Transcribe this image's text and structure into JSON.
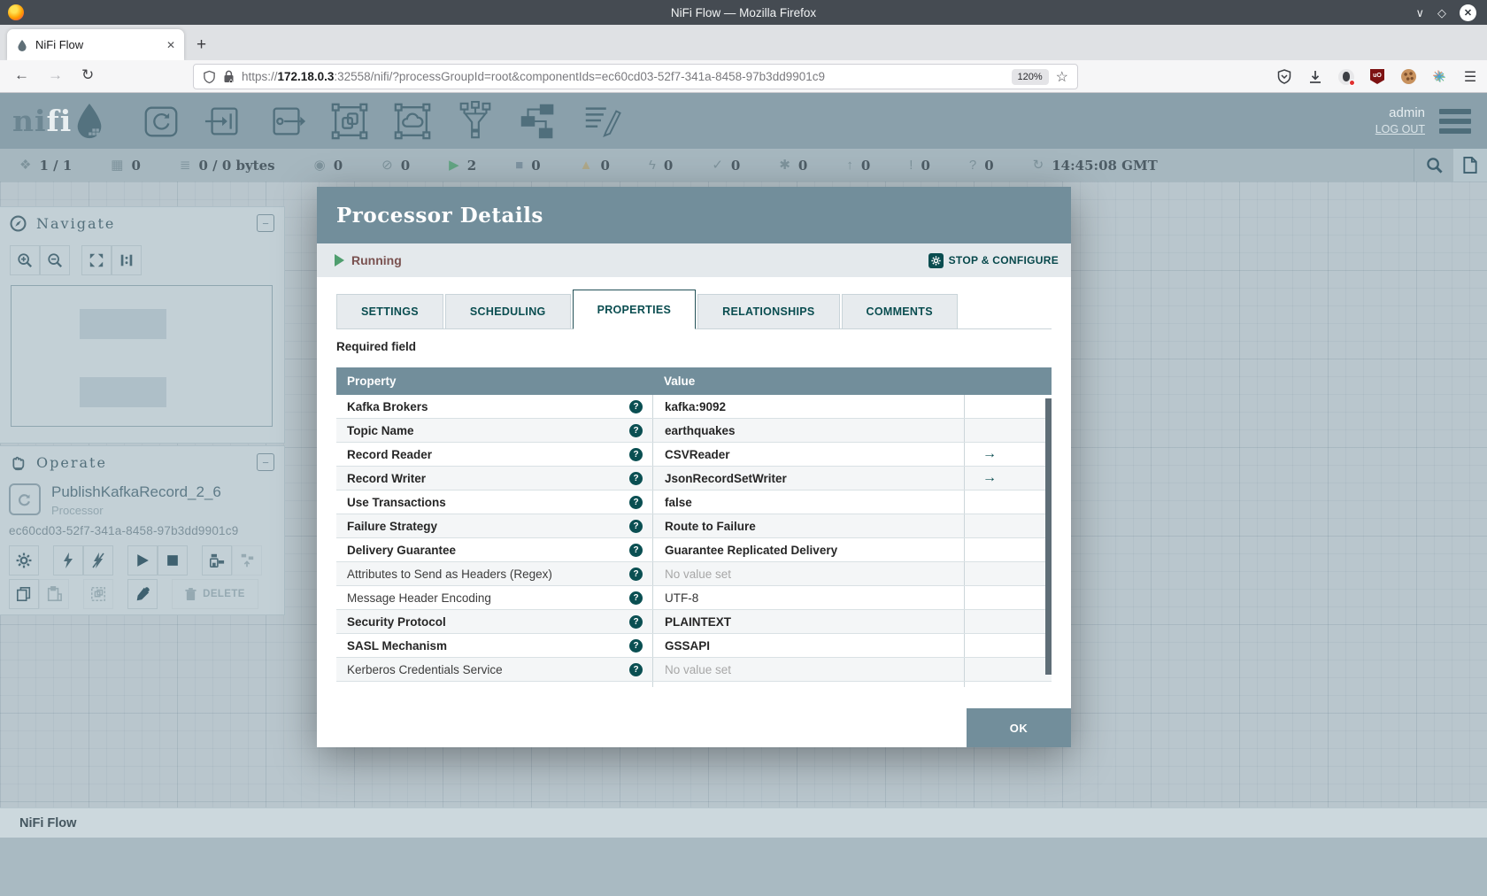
{
  "browser": {
    "window_title": "NiFi Flow — Mozilla Firefox",
    "tab_title": "NiFi Flow",
    "new_tab_label": "+",
    "close_tab_label": "✕",
    "url": {
      "scheme": "https://",
      "host": "172.18.0.3",
      "rest": ":32558/nifi/?processGroupId=root&componentIds=ec60cd03-52f7-341a-8458-97b3dd9901c9"
    },
    "zoom_badge": "120%"
  },
  "nifi": {
    "header": {
      "logo_ni": "ni",
      "logo_fi": "fi",
      "user": "admin",
      "logout": "LOG OUT"
    },
    "status": {
      "items": [
        {
          "name": "cluster-icon",
          "glyph": "❖",
          "value": "1 / 1"
        },
        {
          "name": "active-threads-icon",
          "glyph": "▦",
          "value": "0"
        },
        {
          "name": "queued-icon",
          "glyph": "≣",
          "value": "0 / 0 bytes"
        },
        {
          "name": "transmitting-icon",
          "glyph": "◉",
          "value": "0"
        },
        {
          "name": "not-transmitting-icon",
          "glyph": "⊘",
          "value": "0"
        },
        {
          "name": "running-icon",
          "glyph": "▶",
          "value": "2",
          "color": "#63a584"
        },
        {
          "name": "stopped-icon",
          "glyph": "■",
          "value": "0",
          "color": "#7d93a1"
        },
        {
          "name": "invalid-icon",
          "glyph": "▲",
          "value": "0",
          "color": "#b0a98a"
        },
        {
          "name": "disabled-icon",
          "glyph": "ϟ",
          "value": "0"
        },
        {
          "name": "up-to-date-icon",
          "glyph": "✓",
          "value": "0"
        },
        {
          "name": "locally-modified-icon",
          "glyph": "✱",
          "value": "0"
        },
        {
          "name": "stale-icon",
          "glyph": "↑",
          "value": "0"
        },
        {
          "name": "sync-failure-icon",
          "glyph": "!",
          "value": "0"
        },
        {
          "name": "waiting-icon",
          "glyph": "?",
          "value": "0"
        }
      ],
      "time": "14:45:08 GMT"
    },
    "navigate": {
      "title": "Navigate"
    },
    "operate": {
      "title": "Operate",
      "component_name": "PublishKafkaRecord_2_6",
      "component_type": "Processor",
      "component_id": "ec60cd03-52f7-341a-8458-97b3dd9901c9",
      "delete_label": "DELETE"
    },
    "footer": {
      "breadcrumb": "NiFi Flow"
    }
  },
  "dialog": {
    "title": "Processor Details",
    "run_status": "Running",
    "action_label": "STOP & CONFIGURE",
    "tabs": [
      "SETTINGS",
      "SCHEDULING",
      "PROPERTIES",
      "RELATIONSHIPS",
      "COMMENTS"
    ],
    "active_tab": "PROPERTIES",
    "required_label": "Required field",
    "table": {
      "columns": [
        "Property",
        "Value"
      ],
      "rows": [
        {
          "property": "Kafka Brokers",
          "value": "kafka:9092",
          "required": true,
          "link": false,
          "empty": false
        },
        {
          "property": "Topic Name",
          "value": "earthquakes",
          "required": true,
          "link": false,
          "empty": false
        },
        {
          "property": "Record Reader",
          "value": "CSVReader",
          "required": true,
          "link": true,
          "empty": false
        },
        {
          "property": "Record Writer",
          "value": "JsonRecordSetWriter",
          "required": true,
          "link": true,
          "empty": false
        },
        {
          "property": "Use Transactions",
          "value": "false",
          "required": true,
          "link": false,
          "empty": false
        },
        {
          "property": "Failure Strategy",
          "value": "Route to Failure",
          "required": true,
          "link": false,
          "empty": false
        },
        {
          "property": "Delivery Guarantee",
          "value": "Guarantee Replicated Delivery",
          "required": true,
          "link": false,
          "empty": false
        },
        {
          "property": "Attributes to Send as Headers (Regex)",
          "value": "No value set",
          "required": false,
          "link": false,
          "empty": true
        },
        {
          "property": "Message Header Encoding",
          "value": "UTF-8",
          "required": false,
          "link": false,
          "empty": false
        },
        {
          "property": "Security Protocol",
          "value": "PLAINTEXT",
          "required": true,
          "link": false,
          "empty": false
        },
        {
          "property": "SASL Mechanism",
          "value": "GSSAPI",
          "required": true,
          "link": false,
          "empty": false
        },
        {
          "property": "Kerberos Credentials Service",
          "value": "No value set",
          "required": false,
          "link": false,
          "empty": true
        }
      ]
    },
    "ok_label": "OK"
  },
  "colors": {
    "dialog_accent": "#728e9b",
    "dark_teal": "#0a4d50",
    "running_green": "#4f9e6e",
    "status_maroon": "#7a5250"
  }
}
